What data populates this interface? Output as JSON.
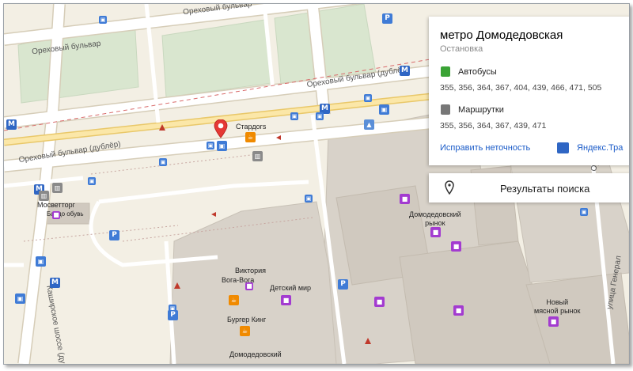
{
  "streets": {
    "orekhovy_top": "Ореховый бульвар",
    "orekhovy_left": "Ореховый бульвар",
    "orekhovy_dubler_mid": "Ореховый бульвар (дублёр)",
    "orekhovy_dubler_left": "Ореховый бульвар (дублёр)",
    "kashirskoe": "Каширское шоссе (дубл",
    "generala": "улица Генерал",
    "right_edge": "Ореховый б"
  },
  "pois": {
    "stardogs": "Стардогs",
    "mosvettorg": "Мосветторг",
    "bardo": "Бардо обувь",
    "domodedovsky_market": "Домодедовский\nрынок",
    "viktoria": "Виктория",
    "vogavoga": "Вога-Вога",
    "detsky_mir": "Детский мир",
    "burger_king": "Бургер Кинг",
    "domodedovsky": "Домодедовский",
    "new_market": "Новый\nмясной рынок"
  },
  "card": {
    "title": "метро Домодедовская",
    "subtitle": "Остановка",
    "buses_label": "Автобусы",
    "buses_routes": "355, 356, 364, 367, 404, 439, 466, 471, 505",
    "minibus_label": "Маршрутки",
    "minibus_routes": "355, 356, 364, 367, 439, 471",
    "fix_link": "Исправить неточность",
    "yandex_link": "Яндекс.Тра",
    "bus_color": "#3aa335",
    "minibus_color": "#777777"
  },
  "search": {
    "label": "Результаты поиска"
  },
  "icons": {
    "metro": "metro-icon",
    "bus": "bus-stop-icon",
    "parking": "parking-icon",
    "shop": "shop-icon",
    "cafe": "cafe-icon",
    "pin": "location-pin-icon"
  }
}
